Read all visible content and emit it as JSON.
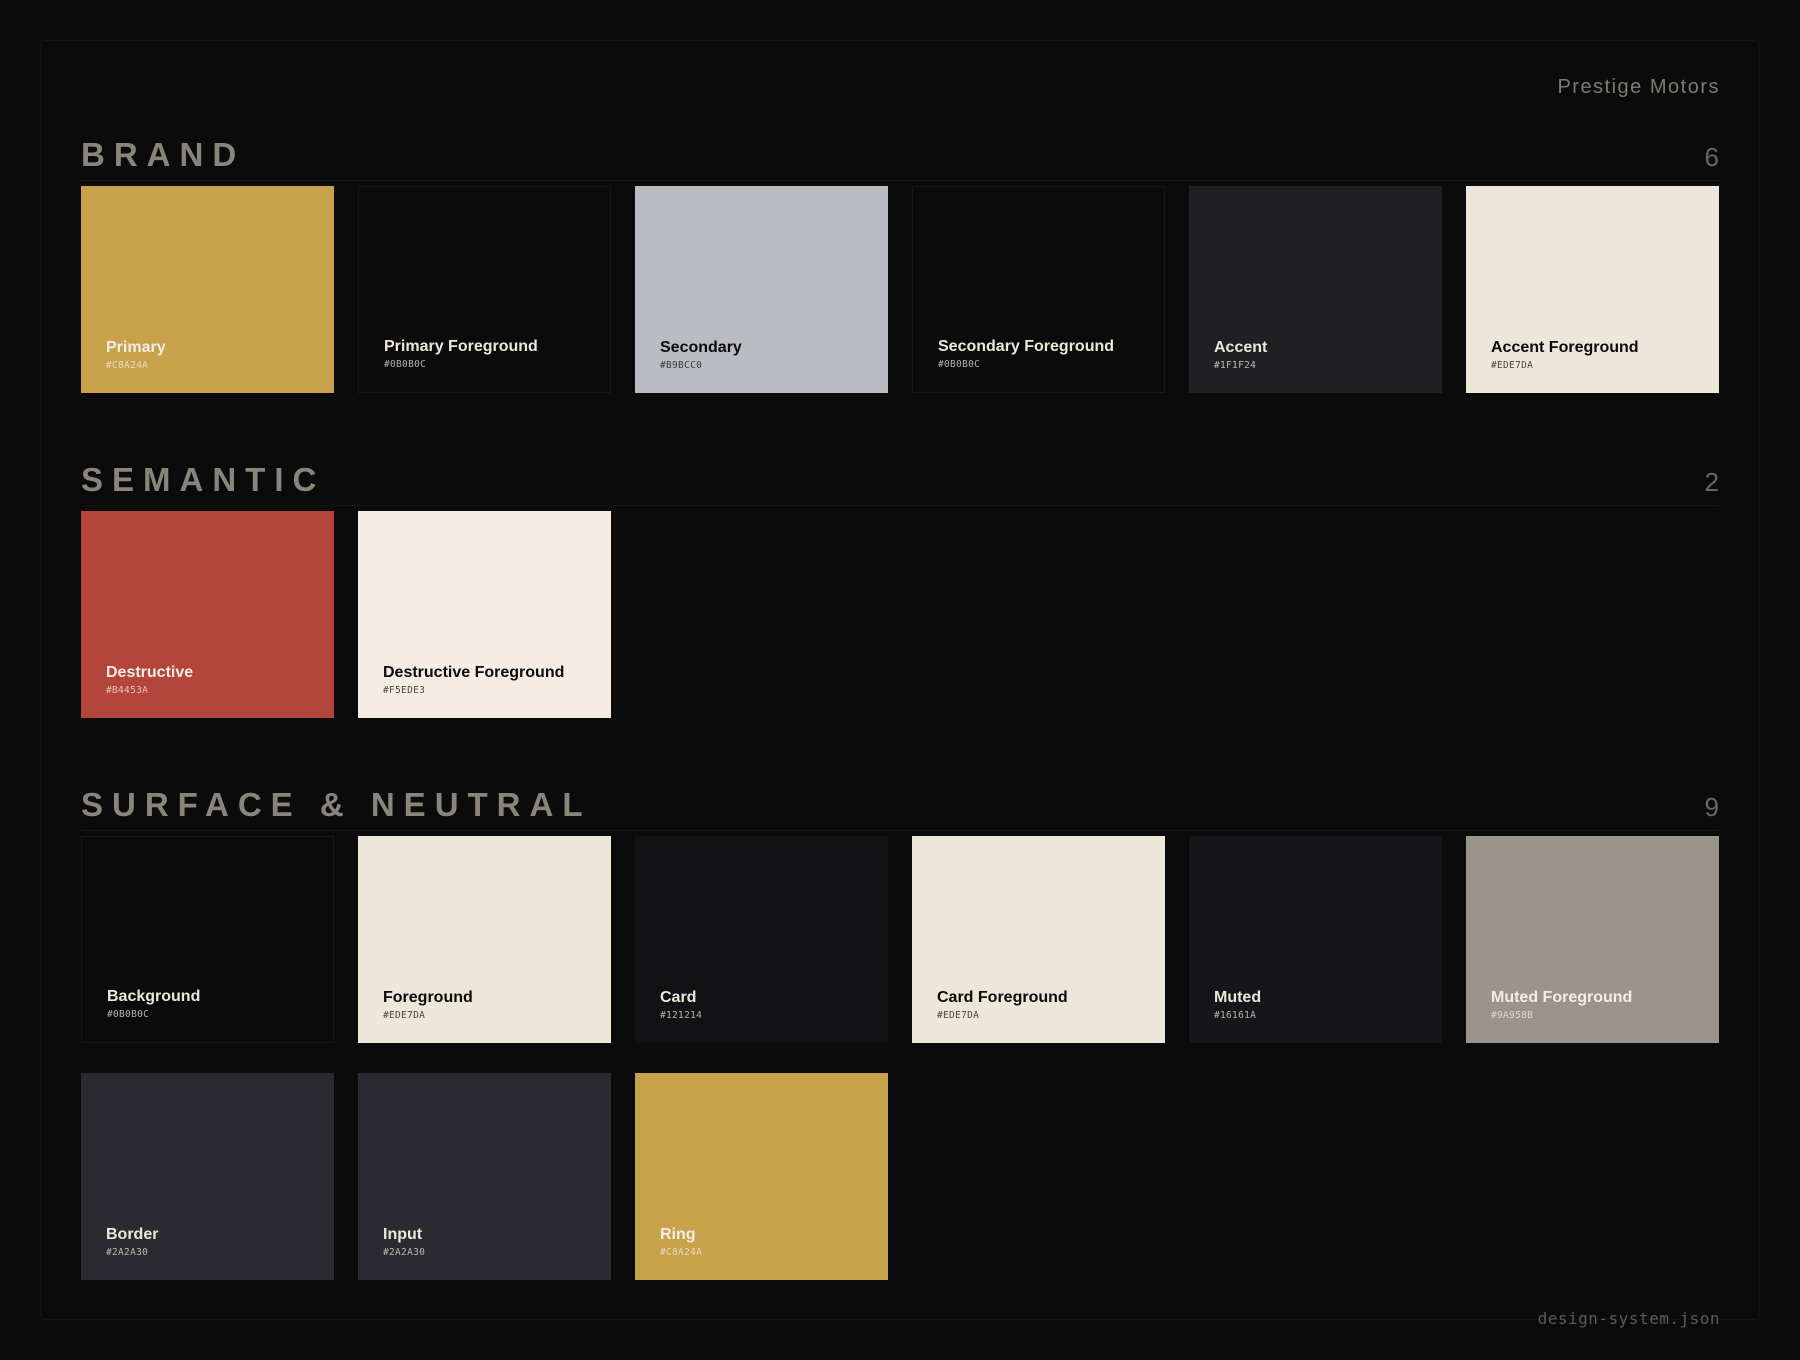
{
  "header": {
    "brand": "Prestige Motors"
  },
  "footer": {
    "file": "design-system.json"
  },
  "sections": [
    {
      "title": "BRAND",
      "count": "6",
      "swatches": [
        {
          "name": "Primary",
          "hex": "#C8A24A",
          "color": "#C8A24A",
          "text_color": "#F5EDE3"
        },
        {
          "name": "Primary Foreground",
          "hex": "#0B0B0C",
          "color": "#0B0B0C",
          "text_color": "#EDE7DA"
        },
        {
          "name": "Secondary",
          "hex": "#B9BCC0",
          "color": "#B9BCC0",
          "text_color": "#0B0B0C"
        },
        {
          "name": "Secondary Foreground",
          "hex": "#0B0B0C",
          "color": "#0B0B0C",
          "text_color": "#EDE7DA"
        },
        {
          "name": "Accent",
          "hex": "#1F1F24",
          "color": "#1F1F24",
          "text_color": "#EDE7DA"
        },
        {
          "name": "Accent Foreground",
          "hex": "#EDE7DA",
          "color": "#EDE7DA",
          "text_color": "#0B0B0C"
        }
      ]
    },
    {
      "title": "SEMANTIC",
      "count": "2",
      "swatches": [
        {
          "name": "Destructive",
          "hex": "#B4453A",
          "color": "#B4453A",
          "text_color": "#F5EDE3"
        },
        {
          "name": "Destructive Foreground",
          "hex": "#F5EDE3",
          "color": "#F5EDE3",
          "text_color": "#0B0B0C"
        }
      ]
    },
    {
      "title": "SURFACE & NEUTRAL",
      "count": "9",
      "swatches": [
        {
          "name": "Background",
          "hex": "#0B0B0C",
          "color": "#0B0B0C",
          "text_color": "#EDE7DA"
        },
        {
          "name": "Foreground",
          "hex": "#EDE7DA",
          "color": "#EDE7DA",
          "text_color": "#0B0B0C"
        },
        {
          "name": "Card",
          "hex": "#121214",
          "color": "#121214",
          "text_color": "#EDE7DA"
        },
        {
          "name": "Card Foreground",
          "hex": "#EDE7DA",
          "color": "#EDE7DA",
          "text_color": "#0B0B0C"
        },
        {
          "name": "Muted",
          "hex": "#16161A",
          "color": "#16161A",
          "text_color": "#EDE7DA"
        },
        {
          "name": "Muted Foreground",
          "hex": "#9A958B",
          "color": "#9A958B",
          "text_color": "#F5EDE3"
        },
        {
          "name": "Border",
          "hex": "#2A2A30",
          "color": "#2A2A30",
          "text_color": "#EDE7DA"
        },
        {
          "name": "Input",
          "hex": "#2A2A30",
          "color": "#2A2A30",
          "text_color": "#EDE7DA"
        },
        {
          "name": "Ring",
          "hex": "#C8A24A",
          "color": "#C8A24A",
          "text_color": "#F5EDE3"
        }
      ]
    }
  ]
}
